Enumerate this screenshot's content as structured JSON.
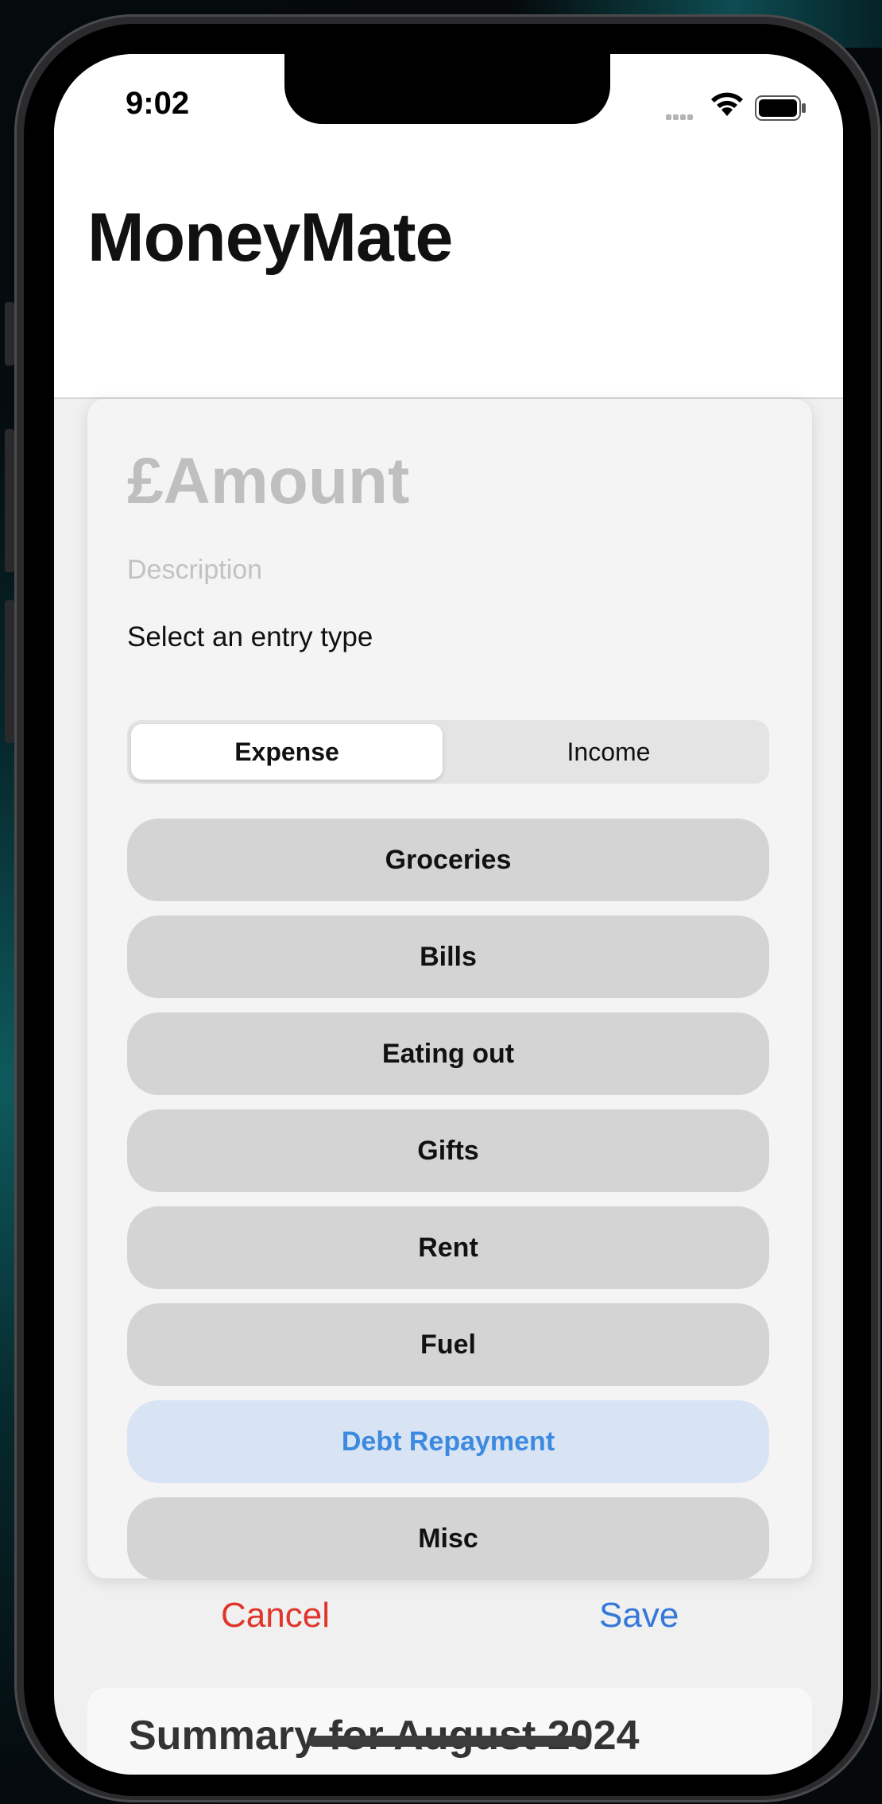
{
  "status_bar": {
    "time": "9:02"
  },
  "header": {
    "title": "MoneyMate"
  },
  "form": {
    "amount_placeholder": "£Amount",
    "description_placeholder": "Description",
    "entry_type_label": "Select an entry type",
    "entry_types": {
      "selected": "Expense",
      "other": "Income"
    },
    "categories": [
      {
        "label": "Groceries",
        "state": "default"
      },
      {
        "label": "Bills",
        "state": "default"
      },
      {
        "label": "Eating out",
        "state": "default"
      },
      {
        "label": "Gifts",
        "state": "default"
      },
      {
        "label": "Rent",
        "state": "default"
      },
      {
        "label": "Fuel",
        "state": "default"
      },
      {
        "label": "Debt Repayment",
        "state": "highlighted"
      },
      {
        "label": "Misc",
        "state": "default"
      }
    ],
    "cancel_label": "Cancel",
    "save_label": "Save"
  },
  "summary": {
    "title": "Summary for August 2024"
  },
  "colors": {
    "accent_blue": "#3478d8",
    "cancel_red": "#e0352b",
    "highlight_bg": "#d8e3f3",
    "highlight_text": "#3c8ae0"
  }
}
